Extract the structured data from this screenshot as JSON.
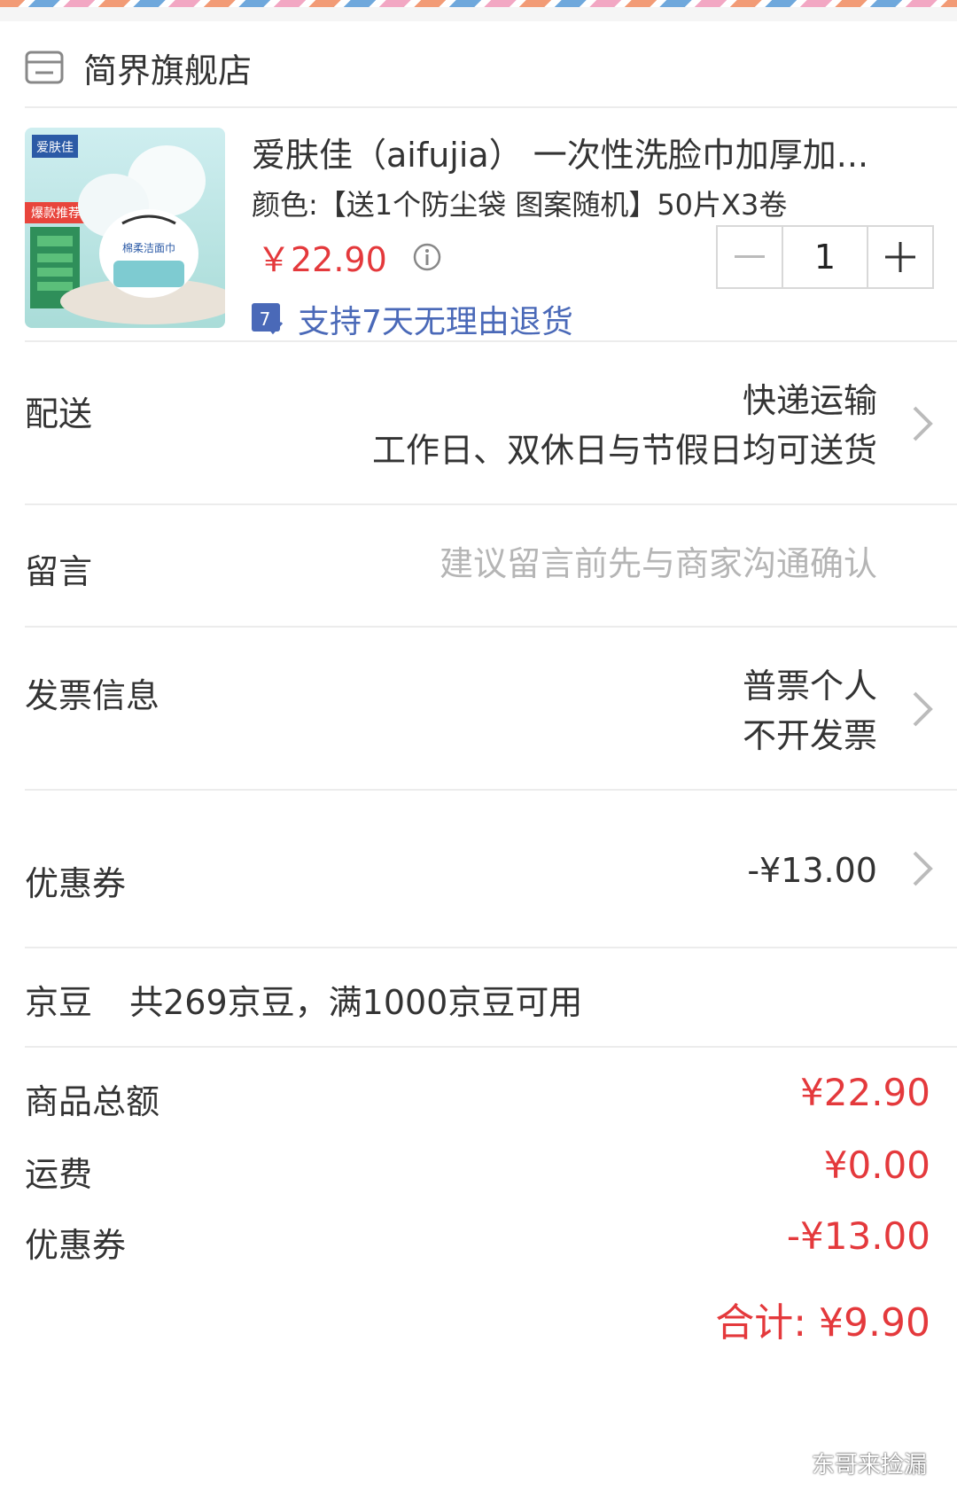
{
  "store": {
    "name": "简界旗舰店",
    "icon": "store-icon"
  },
  "product": {
    "title": "爱肤佳（aifujia） 一次性洗脸巾加厚加...",
    "spec": "颜色:【送1个防尘袋 图案随机】50片X3卷",
    "price": "￥22.90",
    "quantity": "1",
    "return_policy": "支持7天无理由退货",
    "return_badge": "7",
    "image_texts": {
      "brand": "爱肤佳",
      "promo": "爆款推荐",
      "bag_label": "棉柔洁面巾"
    }
  },
  "delivery": {
    "label": "配送",
    "method": "快递运输",
    "schedule": "工作日、双休日与节假日均可送货"
  },
  "message": {
    "label": "留言",
    "placeholder": "建议留言前先与商家沟通确认"
  },
  "invoice": {
    "label": "发票信息",
    "type": "普票个人",
    "status": "不开发票"
  },
  "coupon": {
    "label": "优惠券",
    "value": "-¥13.00"
  },
  "jingdou": {
    "label": "京豆",
    "desc": "共269京豆，满1000京豆可用"
  },
  "summary": {
    "rows": [
      {
        "label": "商品总额",
        "value": "¥22.90"
      },
      {
        "label": "运费",
        "value": "¥0.00"
      },
      {
        "label": "优惠券",
        "value": "-¥13.00"
      }
    ],
    "total": "合计: ¥9.90"
  },
  "watermark": "东哥来捡漏",
  "colors": {
    "price_red": "#e4393c",
    "link_blue": "#4a69b8",
    "divider": "#ececec"
  }
}
